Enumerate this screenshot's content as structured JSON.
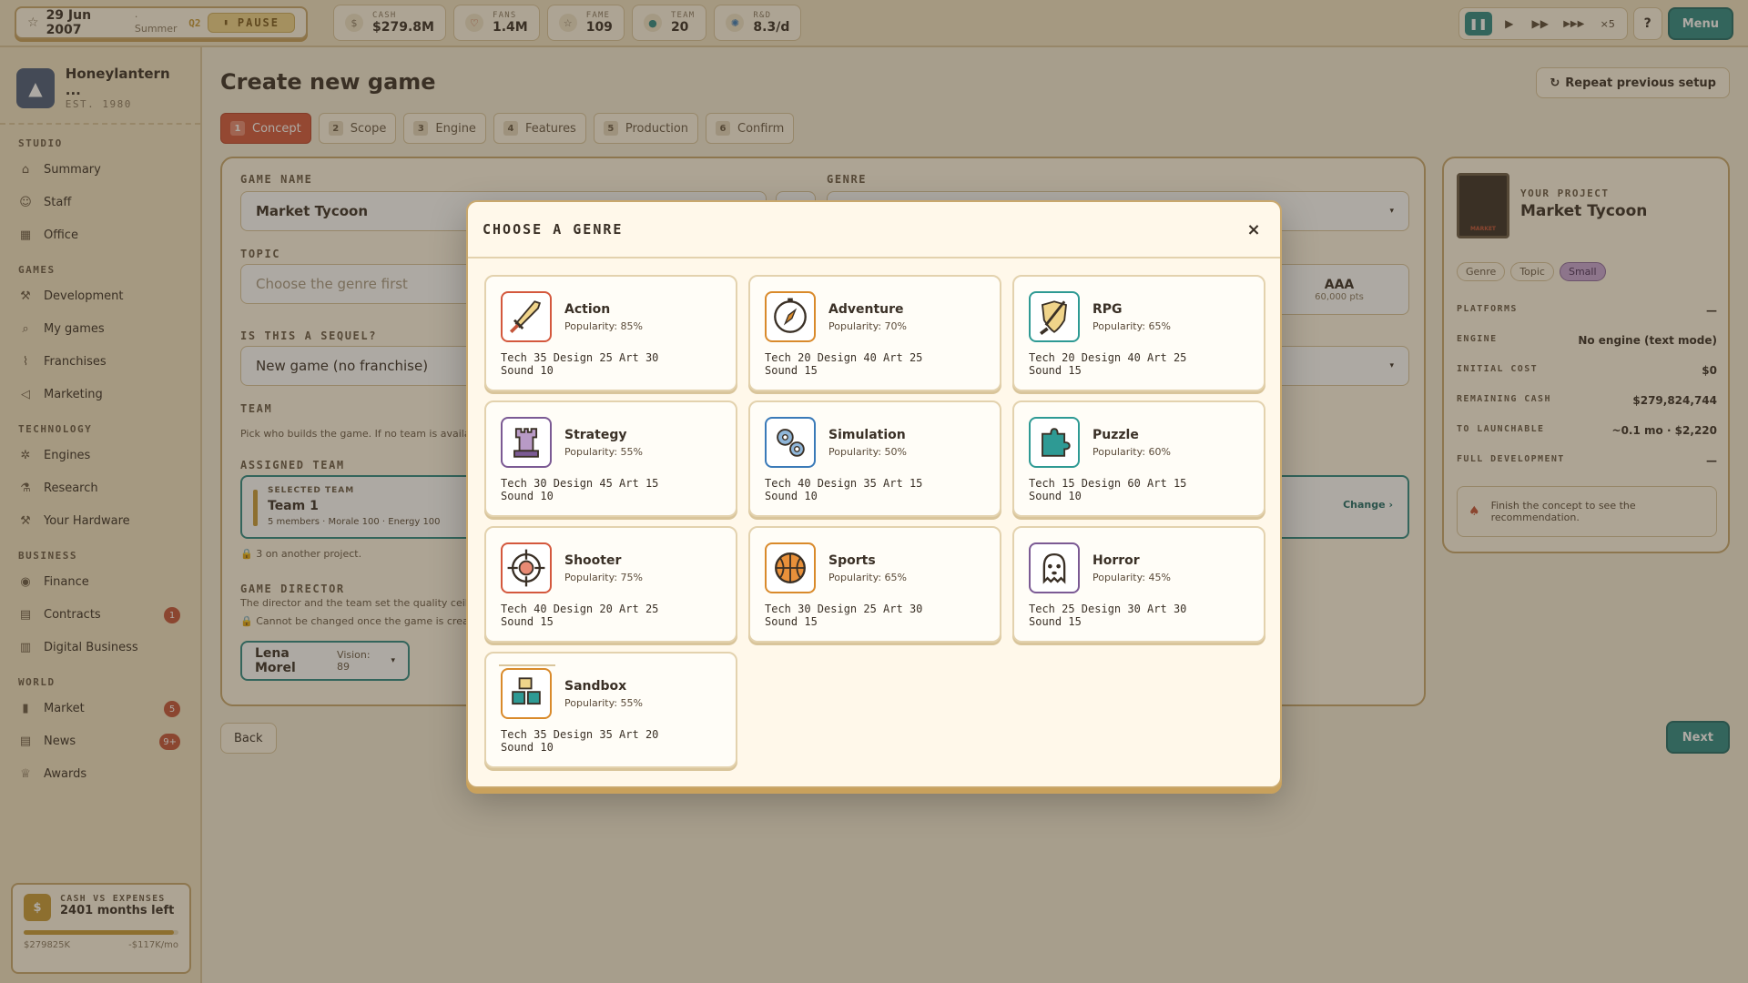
{
  "topbar": {
    "date": "29 Jun 2007",
    "season": "· Summer",
    "quarter": "Q2",
    "pause_label": "PAUSE",
    "stats": [
      {
        "label": "CASH",
        "value": "$279.8M",
        "icon": "money-icon"
      },
      {
        "label": "FANS",
        "value": "1.4M",
        "icon": "heart-icon"
      },
      {
        "label": "FAME",
        "value": "109",
        "icon": "star-icon"
      },
      {
        "label": "TEAM",
        "value": "20",
        "icon": "team-icon"
      },
      {
        "label": "R&D",
        "value": "8.3/d",
        "icon": "atom-icon"
      }
    ],
    "speed_multiplier": "×5",
    "help_label": "?",
    "menu_label": "Menu"
  },
  "sidebar": {
    "studio_name": "Honeylantern ...",
    "studio_est": "EST. 1980",
    "sections": [
      {
        "title": "STUDIO",
        "items": [
          {
            "label": "Summary",
            "icon": "home-icon"
          },
          {
            "label": "Staff",
            "icon": "people-icon"
          },
          {
            "label": "Office",
            "icon": "building-icon"
          }
        ]
      },
      {
        "title": "GAMES",
        "items": [
          {
            "label": "Development",
            "icon": "hammer-icon"
          },
          {
            "label": "My games",
            "icon": "search-icon"
          },
          {
            "label": "Franchises",
            "icon": "chart-icon"
          },
          {
            "label": "Marketing",
            "icon": "megaphone-icon"
          }
        ]
      },
      {
        "title": "TECHNOLOGY",
        "items": [
          {
            "label": "Engines",
            "icon": "gear-icon"
          },
          {
            "label": "Research",
            "icon": "flask-icon"
          },
          {
            "label": "Your Hardware",
            "icon": "hammer-icon"
          }
        ]
      },
      {
        "title": "BUSINESS",
        "items": [
          {
            "label": "Finance",
            "icon": "coin-icon"
          },
          {
            "label": "Contracts",
            "icon": "document-icon",
            "badge": "1"
          },
          {
            "label": "Digital Business",
            "icon": "store-icon"
          }
        ]
      },
      {
        "title": "WORLD",
        "items": [
          {
            "label": "Market",
            "icon": "bar-chart-icon",
            "badge": "5"
          },
          {
            "label": "News",
            "icon": "newspaper-icon",
            "badge": "9+"
          },
          {
            "label": "Awards",
            "icon": "trophy-icon"
          }
        ]
      }
    ],
    "cash": {
      "title": "CASH VS EXPENSES",
      "months": "2401 months left",
      "left": "$279825K",
      "right": "-$117K/mo",
      "bar_fill": 0.97
    }
  },
  "main": {
    "title": "Create new game",
    "repeat_label": "Repeat previous setup",
    "steps": [
      {
        "n": "1",
        "label": "Concept"
      },
      {
        "n": "2",
        "label": "Scope"
      },
      {
        "n": "3",
        "label": "Engine"
      },
      {
        "n": "4",
        "label": "Features"
      },
      {
        "n": "5",
        "label": "Production"
      },
      {
        "n": "6",
        "label": "Confirm"
      }
    ],
    "form": {
      "game_name_label": "GAME NAME",
      "game_name_value": "Market Tycoon",
      "genre_label": "GENRE",
      "topic_label": "TOPIC",
      "topic_placeholder": "Choose the genre first",
      "aaa_label": "AAA",
      "aaa_pts": "60,000 pts",
      "sequel_label": "IS THIS A SEQUEL?",
      "sequel_value": "New game (no franchise)",
      "team_label": "TEAM",
      "team_desc": "Pick who builds the game. If no team is availa",
      "assigned_label": "ASSIGNED TEAM",
      "selected_team_label": "SELECTED TEAM",
      "team_name": "Team 1",
      "team_meta": "5 members · Morale 100 · Energy 100",
      "team_change": "Change",
      "team_note": "3 on another project.",
      "director_label": "GAME DIRECTOR",
      "director_desc": "The director and the team set the quality ceil",
      "director_note": "Cannot be changed once the game is created",
      "director_name": "Lena Morel",
      "director_vision": "Vision: 89"
    },
    "project": {
      "label": "YOUR PROJECT",
      "name": "Market Tycoon",
      "thumb_text": "MARKET",
      "chips": [
        "Genre",
        "Topic",
        "Small"
      ],
      "rows": [
        {
          "k": "PLATFORMS",
          "v": "—"
        },
        {
          "k": "ENGINE",
          "v": "No engine (text mode)"
        },
        {
          "k": "INITIAL COST",
          "v": "$0"
        },
        {
          "k": "REMAINING CASH",
          "v": "$279,824,744"
        },
        {
          "k": "TO LAUNCHABLE",
          "v": "~0.1 mo · $2,220"
        },
        {
          "k": "FULL DEVELOPMENT",
          "v": "—"
        }
      ],
      "hint": "Finish the concept to see the recommendation."
    },
    "back_label": "Back",
    "next_label": "Next"
  },
  "modal": {
    "title": "CHOOSE A GENRE",
    "close": "×",
    "genres": [
      {
        "name": "Action",
        "popularity": "Popularity: 85%",
        "stats": "Tech 35 Design 25 Art 30",
        "sound": "Sound 10",
        "icon": "sword-icon",
        "color": "#d4583d"
      },
      {
        "name": "Adventure",
        "popularity": "Popularity: 70%",
        "stats": "Tech 20 Design 40 Art 25",
        "sound": "Sound 15",
        "icon": "compass-icon",
        "color": "#d98a2b"
      },
      {
        "name": "RPG",
        "popularity": "Popularity: 65%",
        "stats": "Tech 20 Design 40 Art 25",
        "sound": "Sound 15",
        "icon": "shield-sword-icon",
        "color": "#2e9a94"
      },
      {
        "name": "Strategy",
        "popularity": "Popularity: 55%",
        "stats": "Tech 30 Design 45 Art 15",
        "sound": "Sound 10",
        "icon": "rook-icon",
        "color": "#7b5a94"
      },
      {
        "name": "Simulation",
        "popularity": "Popularity: 50%",
        "stats": "Tech 40 Design 35 Art 15",
        "sound": "Sound 10",
        "icon": "gears-icon",
        "color": "#3a7ab8"
      },
      {
        "name": "Puzzle",
        "popularity": "Popularity: 60%",
        "stats": "Tech 15 Design 60 Art 15",
        "sound": "Sound 10",
        "icon": "puzzle-icon",
        "color": "#2e9a94"
      },
      {
        "name": "Shooter",
        "popularity": "Popularity: 75%",
        "stats": "Tech 40 Design 20 Art 25",
        "sound": "Sound 15",
        "icon": "crosshair-icon",
        "color": "#d4583d"
      },
      {
        "name": "Sports",
        "popularity": "Popularity: 65%",
        "stats": "Tech 30 Design 25 Art 30",
        "sound": "Sound 15",
        "icon": "basketball-icon",
        "color": "#d98a2b"
      },
      {
        "name": "Horror",
        "popularity": "Popularity: 45%",
        "stats": "Tech 25 Design 30 Art 30",
        "sound": "Sound 15",
        "icon": "ghost-icon",
        "color": "#7b5a94"
      },
      {
        "name": "Sandbox",
        "popularity": "Popularity: 55%",
        "stats": "Tech 35 Design 35 Art 20",
        "sound": "Sound 10",
        "icon": "blocks-icon",
        "color": "#d98a2b"
      }
    ]
  }
}
